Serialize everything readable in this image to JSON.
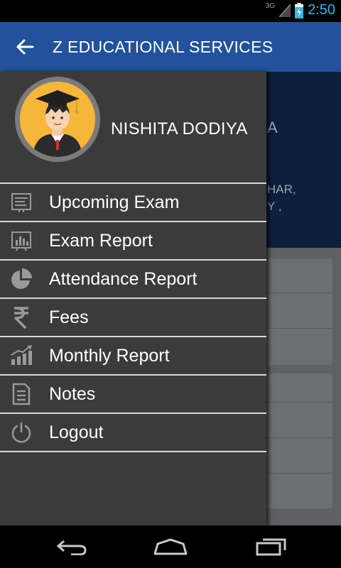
{
  "status_bar": {
    "network": "3G",
    "time": "2:50"
  },
  "app_bar": {
    "title": "Z EDUCATIONAL SERVICES"
  },
  "background": {
    "line1": "A",
    "line2": "HAR,",
    "line3": "Y ,"
  },
  "drawer": {
    "user_name": "NISHITA DODIYA",
    "menu": [
      {
        "label": "Upcoming Exam",
        "icon": "exam-list-icon"
      },
      {
        "label": "Exam Report",
        "icon": "bar-chart-icon"
      },
      {
        "label": "Attendance Report",
        "icon": "pie-chart-icon"
      },
      {
        "label": "Fees",
        "icon": "rupee-icon"
      },
      {
        "label": "Monthly Report",
        "icon": "growth-chart-icon"
      },
      {
        "label": "Notes",
        "icon": "notes-icon"
      },
      {
        "label": "Logout",
        "icon": "power-icon"
      }
    ]
  },
  "colors": {
    "app_bar": "#22529c",
    "drawer": "#3b3b3c",
    "accent": "#33b5e5",
    "avatar_bg": "#f6b63a"
  }
}
